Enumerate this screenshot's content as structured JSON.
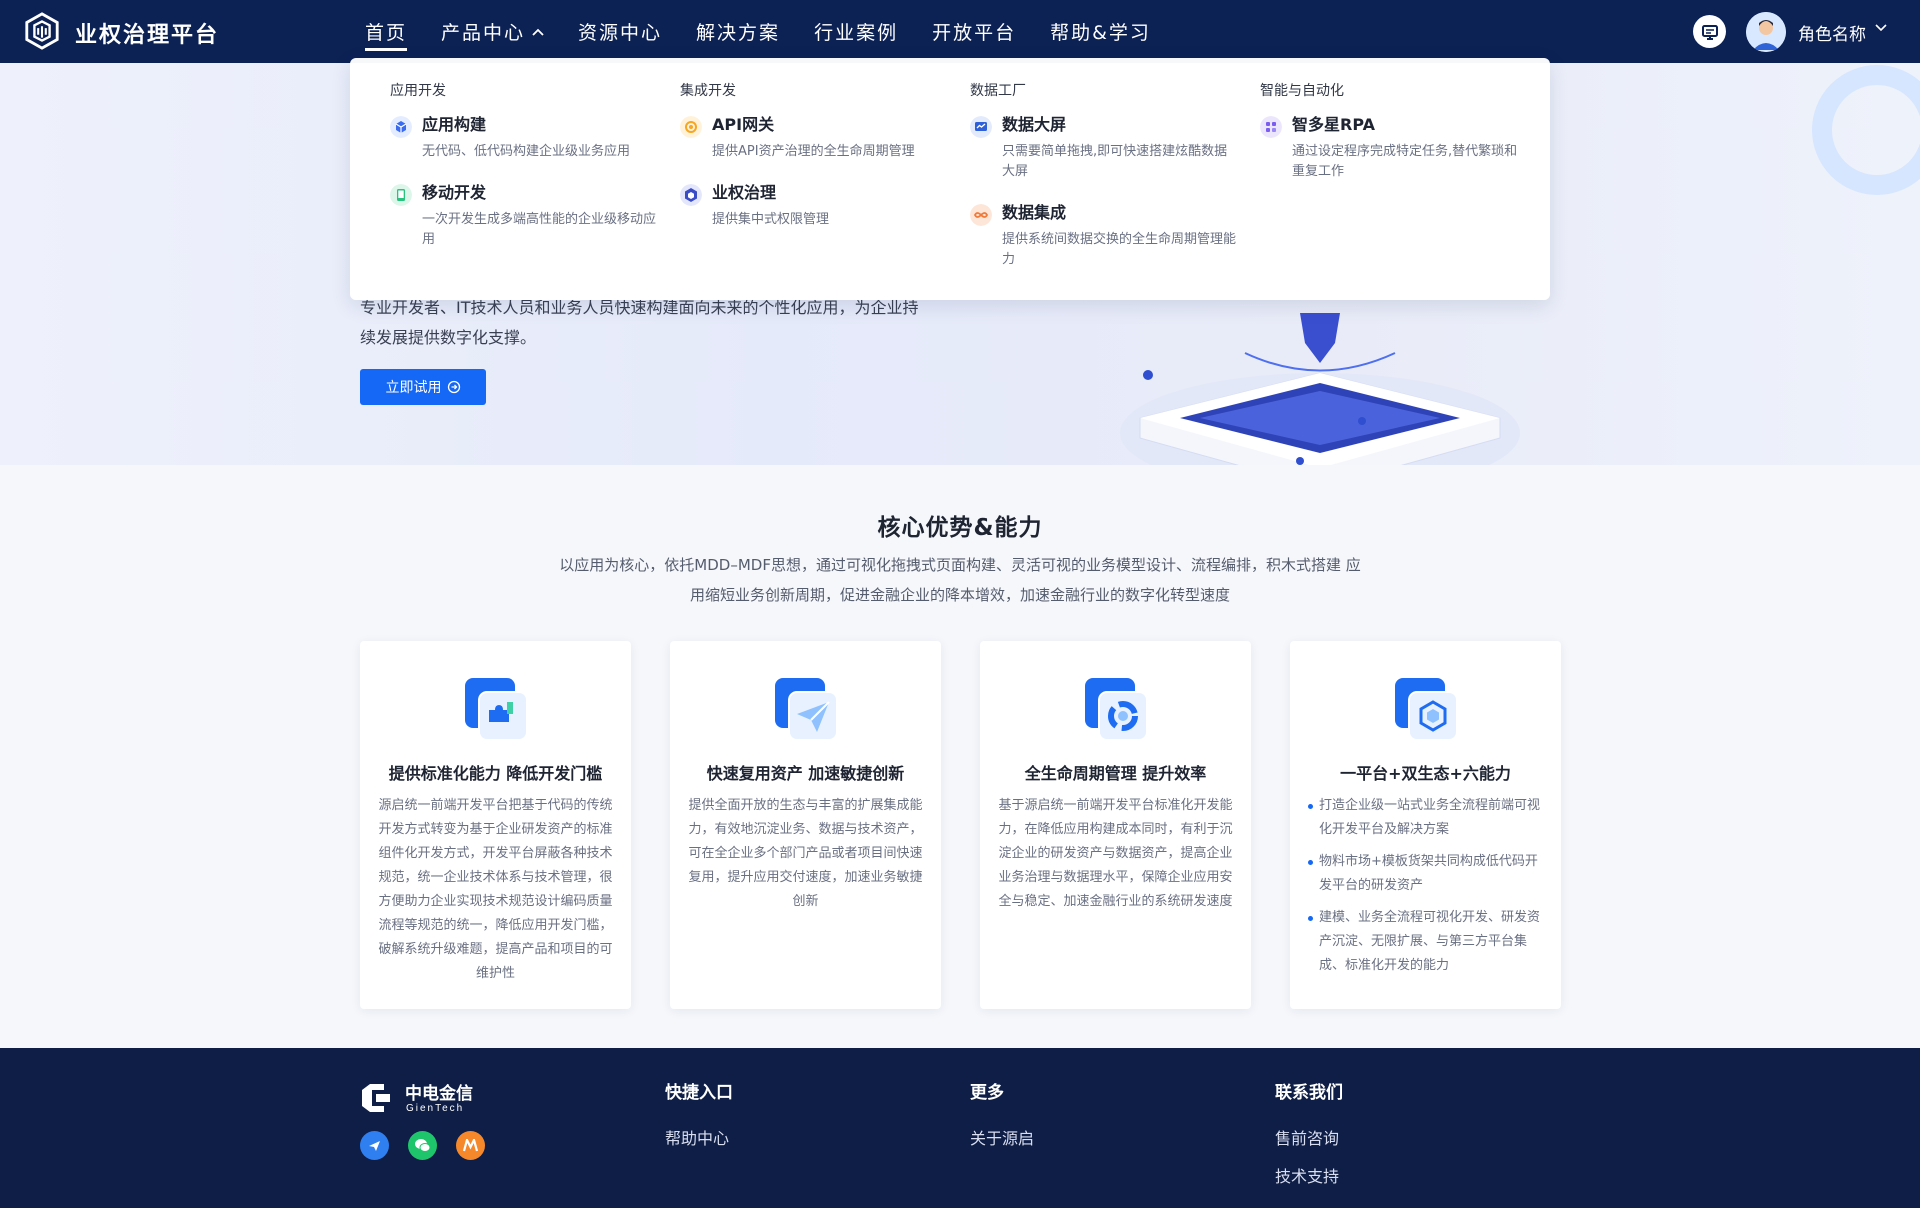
{
  "header": {
    "brand": "业权治理平台",
    "nav": [
      "首页",
      "产品中心",
      "资源中心",
      "解决方案",
      "行业案例",
      "开放平台",
      "帮助&学习"
    ],
    "active_index": 0,
    "expanded_index": 1,
    "user_name": "角色名称"
  },
  "dropdown": {
    "columns": [
      {
        "category": "应用开发",
        "items": [
          {
            "title": "应用构建",
            "desc": "无代码、低代码构建企业级业务应用",
            "icon": "cube-icon",
            "color": "#3b6cf0"
          },
          {
            "title": "移动开发",
            "desc": "一次开发生成多端高性能的企业级移动应用",
            "icon": "mobile-icon",
            "color": "#29c27f"
          }
        ]
      },
      {
        "category": "集成开发",
        "items": [
          {
            "title": "API网关",
            "desc": "提供API资产治理的全生命周期管理",
            "icon": "gateway-icon",
            "color": "#f5a623"
          },
          {
            "title": "业权治理",
            "desc": "提供集中式权限管理",
            "icon": "hexagon-icon",
            "color": "#3b4cc7"
          }
        ]
      },
      {
        "category": "数据工厂",
        "items": [
          {
            "title": "数据大屏",
            "desc": "只需要简单拖拽,即可快速搭建炫酷数据大屏",
            "icon": "chart-screen-icon",
            "color": "#2f5fd8"
          },
          {
            "title": "数据集成",
            "desc": "提供系统间数据交换的全生命周期管理能力",
            "icon": "infinity-icon",
            "color": "#f07a3a"
          }
        ]
      },
      {
        "category": "智能与自动化",
        "items": [
          {
            "title": "智多星RPA",
            "desc": "通过设定程序完成特定任务,替代繁琐和重复工作",
            "icon": "grid-icon",
            "color": "#7a5cf0"
          }
        ]
      }
    ]
  },
  "hero": {
    "text": "专业开发者、IT技术人员和业务人员快速构建面向未来的个性化应用，为企业持续发展提供数字化支撑。",
    "button": "立即试用"
  },
  "advantages": {
    "title": "核心优势&能力",
    "subtitle": "以应用为核心，依托MDD–MDF思想，通过可视化拖拽式页面构建、灵活可视的业务模型设计、流程编排，积木式搭建 应用缩短业务创新周期，促进金融企业的降本增效，加速金融行业的数字化转型速度",
    "cards": [
      {
        "title": "提供标准化能力  降低开发门槛",
        "body": "源启统一前端开发平台把基于代码的传统开发方式转变为基于企业研发资产的标准组件化开发方式，开发平台屏蔽各种技术规范，统一企业技术体系与技术管理，很方便助力企业实现技术规范设计编码质量流程等规范的统一，降低应用开发门槛，破解系统升级难题，提高产品和项目的可维护性"
      },
      {
        "title": "快速复用资产  加速敏捷创新",
        "body": "提供全面开放的生态与丰富的扩展集成能力，有效地沉淀业务、数据与技术资产，可在全企业多个部门产品或者项目间快速复用，提升应用交付速度，加速业务敏捷创新"
      },
      {
        "title": "全生命周期管理  提升效率",
        "body": "基于源启统一前端开发平台标准化开发能力，在降低应用构建成本同时，有利于沉淀企业的研发资产与数据资产，提高企业业务治理与数据理水平，保障企业应用安全与稳定、加速金融行业的系统研发速度"
      },
      {
        "title": "一平台+双生态+六能力",
        "list": [
          "打造企业级一站式业务全流程前端可视化开发平台及解决方案",
          "物料市场+模板货架共同构成低代码开发平台的研发资产",
          "建模、业务全流程可视化开发、研发资产沉淀、无限扩展、与第三方平台集成、标准化开发的能力"
        ]
      }
    ]
  },
  "footer": {
    "logo_cn": "中电金信",
    "logo_en": "GienTech",
    "columns": [
      {
        "head": "快捷入口",
        "links": [
          "帮助中心"
        ]
      },
      {
        "head": "更多",
        "links": [
          "关于源启"
        ]
      },
      {
        "head": "联系我们",
        "links": [
          "售前咨询",
          "技术支持"
        ]
      }
    ]
  },
  "colors": {
    "header_bg": "#0c2154",
    "primary": "#1468f5",
    "footer_bg": "#0e1e46"
  }
}
